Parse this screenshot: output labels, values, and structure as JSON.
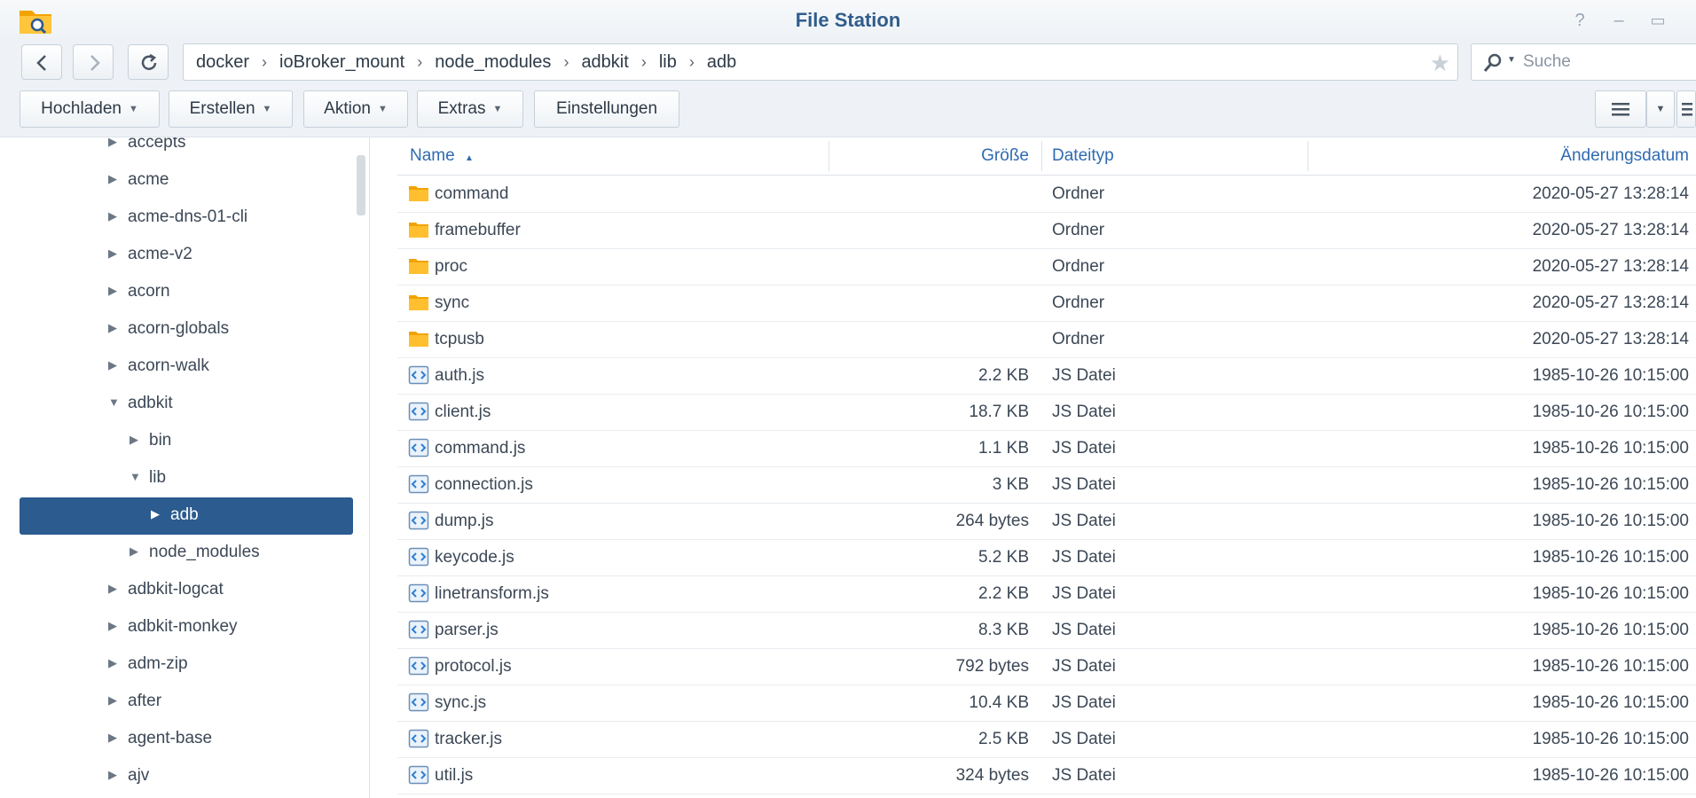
{
  "window": {
    "title": "File Station",
    "controls": [
      "help-icon",
      "minimize-icon",
      "maximize-icon"
    ]
  },
  "nav": {
    "breadcrumb": [
      "docker",
      "ioBroker_mount",
      "node_modules",
      "adbkit",
      "lib",
      "adb"
    ],
    "search_placeholder": "Suche"
  },
  "toolbar": {
    "upload": "Hochladen",
    "create": "Erstellen",
    "action": "Aktion",
    "extras": "Extras",
    "settings": "Einstellungen"
  },
  "tree": {
    "items": [
      {
        "label": "accepts",
        "level": 0,
        "state": "collapsed"
      },
      {
        "label": "acme",
        "level": 0,
        "state": "collapsed"
      },
      {
        "label": "acme-dns-01-cli",
        "level": 0,
        "state": "collapsed"
      },
      {
        "label": "acme-v2",
        "level": 0,
        "state": "collapsed"
      },
      {
        "label": "acorn",
        "level": 0,
        "state": "collapsed"
      },
      {
        "label": "acorn-globals",
        "level": 0,
        "state": "collapsed"
      },
      {
        "label": "acorn-walk",
        "level": 0,
        "state": "collapsed"
      },
      {
        "label": "adbkit",
        "level": 0,
        "state": "expanded"
      },
      {
        "label": "bin",
        "level": 1,
        "state": "collapsed"
      },
      {
        "label": "lib",
        "level": 1,
        "state": "expanded"
      },
      {
        "label": "adb",
        "level": 2,
        "state": "collapsed",
        "selected": true
      },
      {
        "label": "node_modules",
        "level": 1,
        "state": "collapsed"
      },
      {
        "label": "adbkit-logcat",
        "level": 0,
        "state": "collapsed"
      },
      {
        "label": "adbkit-monkey",
        "level": 0,
        "state": "collapsed"
      },
      {
        "label": "adm-zip",
        "level": 0,
        "state": "collapsed"
      },
      {
        "label": "after",
        "level": 0,
        "state": "collapsed"
      },
      {
        "label": "agent-base",
        "level": 0,
        "state": "collapsed"
      },
      {
        "label": "ajv",
        "level": 0,
        "state": "collapsed"
      }
    ]
  },
  "list": {
    "columns": {
      "name": "Name",
      "size": "Größe",
      "type": "Dateityp",
      "modified": "Änderungsdatum"
    },
    "sort_indicator": "▲",
    "rows": [
      {
        "name": "command",
        "size": "",
        "type": "Ordner",
        "modified": "2020-05-27 13:28:14",
        "kind": "folder"
      },
      {
        "name": "framebuffer",
        "size": "",
        "type": "Ordner",
        "modified": "2020-05-27 13:28:14",
        "kind": "folder"
      },
      {
        "name": "proc",
        "size": "",
        "type": "Ordner",
        "modified": "2020-05-27 13:28:14",
        "kind": "folder"
      },
      {
        "name": "sync",
        "size": "",
        "type": "Ordner",
        "modified": "2020-05-27 13:28:14",
        "kind": "folder"
      },
      {
        "name": "tcpusb",
        "size": "",
        "type": "Ordner",
        "modified": "2020-05-27 13:28:14",
        "kind": "folder"
      },
      {
        "name": "auth.js",
        "size": "2.2 KB",
        "type": "JS Datei",
        "modified": "1985-10-26 10:15:00",
        "kind": "js"
      },
      {
        "name": "client.js",
        "size": "18.7 KB",
        "type": "JS Datei",
        "modified": "1985-10-26 10:15:00",
        "kind": "js"
      },
      {
        "name": "command.js",
        "size": "1.1 KB",
        "type": "JS Datei",
        "modified": "1985-10-26 10:15:00",
        "kind": "js"
      },
      {
        "name": "connection.js",
        "size": "3 KB",
        "type": "JS Datei",
        "modified": "1985-10-26 10:15:00",
        "kind": "js"
      },
      {
        "name": "dump.js",
        "size": "264 bytes",
        "type": "JS Datei",
        "modified": "1985-10-26 10:15:00",
        "kind": "js"
      },
      {
        "name": "keycode.js",
        "size": "5.2 KB",
        "type": "JS Datei",
        "modified": "1985-10-26 10:15:00",
        "kind": "js"
      },
      {
        "name": "linetransform.js",
        "size": "2.2 KB",
        "type": "JS Datei",
        "modified": "1985-10-26 10:15:00",
        "kind": "js"
      },
      {
        "name": "parser.js",
        "size": "8.3 KB",
        "type": "JS Datei",
        "modified": "1985-10-26 10:15:00",
        "kind": "js"
      },
      {
        "name": "protocol.js",
        "size": "792 bytes",
        "type": "JS Datei",
        "modified": "1985-10-26 10:15:00",
        "kind": "js"
      },
      {
        "name": "sync.js",
        "size": "10.4 KB",
        "type": "JS Datei",
        "modified": "1985-10-26 10:15:00",
        "kind": "js"
      },
      {
        "name": "tracker.js",
        "size": "2.5 KB",
        "type": "JS Datei",
        "modified": "1985-10-26 10:15:00",
        "kind": "js"
      },
      {
        "name": "util.js",
        "size": "324 bytes",
        "type": "JS Datei",
        "modified": "1985-10-26 10:15:00",
        "kind": "js"
      }
    ]
  },
  "colors": {
    "accent": "#2b5b8f",
    "folder": "#f7b320",
    "header_text": "#2f6ab0"
  }
}
